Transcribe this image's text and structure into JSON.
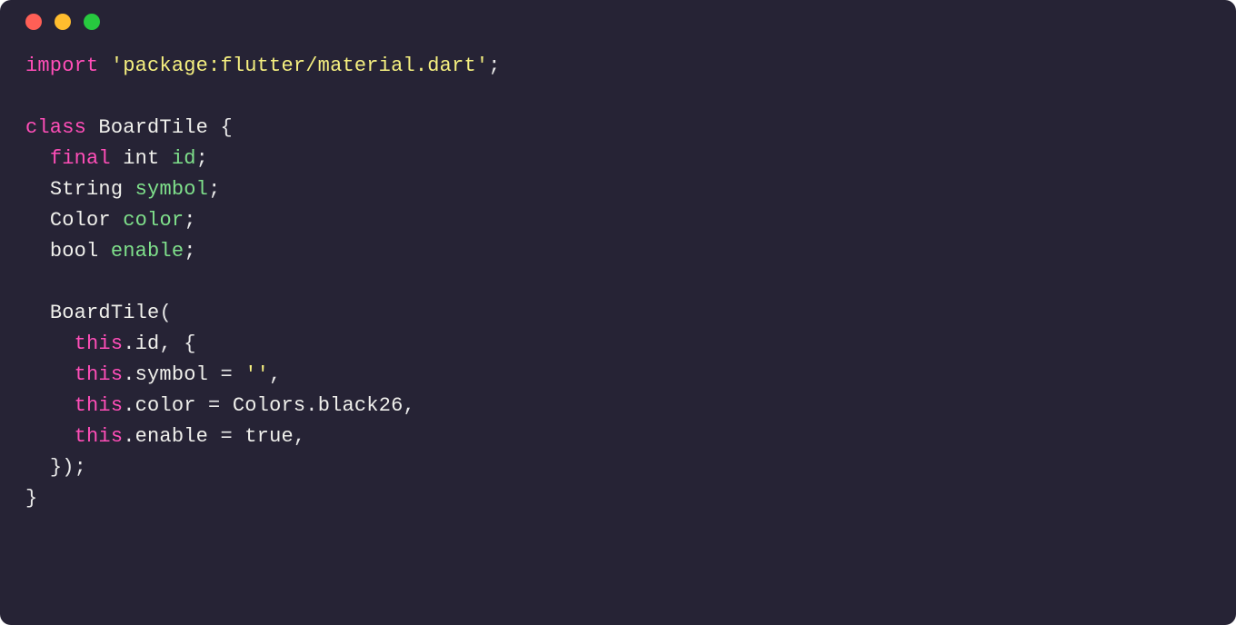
{
  "titlebar": {
    "close": "close",
    "minimize": "minimize",
    "zoom": "zoom"
  },
  "code": {
    "l1": {
      "kw_import": "import",
      "sp1": " ",
      "str": "'package:flutter/material.dart'",
      "semi": ";"
    },
    "l2": "",
    "l3": {
      "kw_class": "class",
      "sp1": " ",
      "name": "BoardTile",
      "sp2": " ",
      "brace": "{"
    },
    "l4": {
      "indent": "  ",
      "kw_final": "final",
      "sp1": " ",
      "type": "int",
      "sp2": " ",
      "ident": "id",
      "semi": ";"
    },
    "l5": {
      "indent": "  ",
      "type": "String",
      "sp1": " ",
      "ident": "symbol",
      "semi": ";"
    },
    "l6": {
      "indent": "  ",
      "type": "Color",
      "sp1": " ",
      "ident": "color",
      "semi": ";"
    },
    "l7": {
      "indent": "  ",
      "type": "bool",
      "sp1": " ",
      "ident": "enable",
      "semi": ";"
    },
    "l8": "",
    "l9": {
      "indent": "  ",
      "ctor": "BoardTile",
      "paren": "("
    },
    "l10": {
      "indent": "    ",
      "this": "this",
      "dot": ".",
      "prop": "id",
      "rest": ", {"
    },
    "l11": {
      "indent": "    ",
      "this": "this",
      "dot": ".",
      "prop": "symbol",
      "sp": " ",
      "eq": "=",
      "sp2": " ",
      "val": "''",
      "comma": ","
    },
    "l12": {
      "indent": "    ",
      "this": "this",
      "dot": ".",
      "prop": "color",
      "sp": " ",
      "eq": "=",
      "sp2": " ",
      "val1": "Colors",
      "dot2": ".",
      "val2": "black26",
      "comma": ","
    },
    "l13": {
      "indent": "    ",
      "this": "this",
      "dot": ".",
      "prop": "enable",
      "sp": " ",
      "eq": "=",
      "sp2": " ",
      "val": "true",
      "comma": ","
    },
    "l14": {
      "indent": "  ",
      "close": "});"
    },
    "l15": {
      "brace": "}"
    }
  }
}
